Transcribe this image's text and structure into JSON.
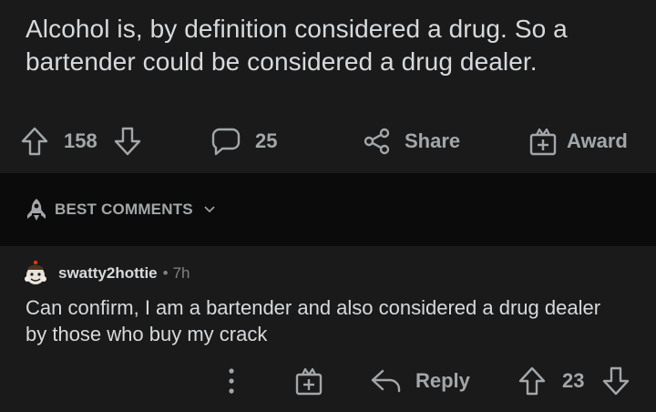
{
  "post": {
    "title": "Alcohol is, by definition considered a drug. So a bartender could be considered a drug dealer.",
    "votes": "158",
    "comments": "25",
    "share_label": "Share",
    "award_label": "Award"
  },
  "sort": {
    "label": "BEST COMMENTS"
  },
  "comment": {
    "author": "swatty2hottie",
    "separator": "•",
    "time": "7h",
    "body": "Can confirm, I am a bartender and also considered a drug dealer by those who buy my crack",
    "reply_label": "Reply",
    "votes": "23"
  },
  "colors": {
    "background": "#1a1a1b",
    "sort_bar_background": "#0b0b0b",
    "primary_text": "#d7dadc",
    "icon_gray": "#a3a7a9",
    "meta_gray": "#818384"
  }
}
